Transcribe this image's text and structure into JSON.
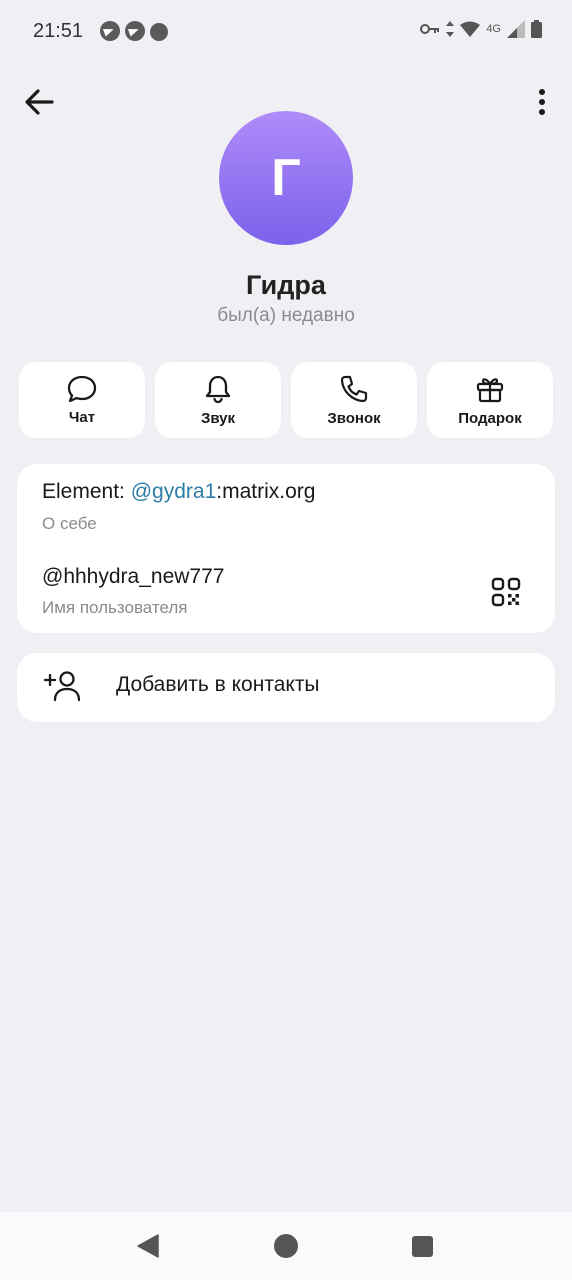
{
  "status_bar": {
    "time": "21:51",
    "network": "4G",
    "left_icons": [
      "telegram-icon",
      "telegram-icon",
      "bot-icon"
    ],
    "right_icons": [
      "vpn-key-icon",
      "data-arrows-icon",
      "wifi-icon",
      "signal-icon",
      "battery-icon"
    ]
  },
  "header": {
    "back_icon": "arrow-left-icon",
    "menu_icon": "more-vertical-icon"
  },
  "profile": {
    "avatar_letter": "Г",
    "name": "Гидра",
    "last_seen": "был(а) недавно",
    "avatar_colors": [
      "#b08cf9",
      "#7c62ec"
    ]
  },
  "actions": [
    {
      "label": "Чат",
      "icon": "chat-bubble-icon"
    },
    {
      "label": "Звук",
      "icon": "bell-icon"
    },
    {
      "label": "Звонок",
      "icon": "phone-icon"
    },
    {
      "label": "Подарок",
      "icon": "gift-icon"
    }
  ],
  "info": {
    "bio_prefix": "Element: ",
    "bio_link": "@gydra1",
    "bio_suffix": ":matrix.org",
    "bio_label": "О себе",
    "username": "@hhhydra_new777",
    "username_label": "Имя пользователя",
    "qr_icon": "qr-code-icon"
  },
  "add_contact": {
    "label": "Добавить в контакты",
    "icon": "add-user-icon"
  },
  "nav": [
    "back-triangle-icon",
    "home-circle-icon",
    "recents-square-icon"
  ],
  "colors": {
    "accent_link": "#2e7ea8",
    "background": "#f0f0f4"
  }
}
